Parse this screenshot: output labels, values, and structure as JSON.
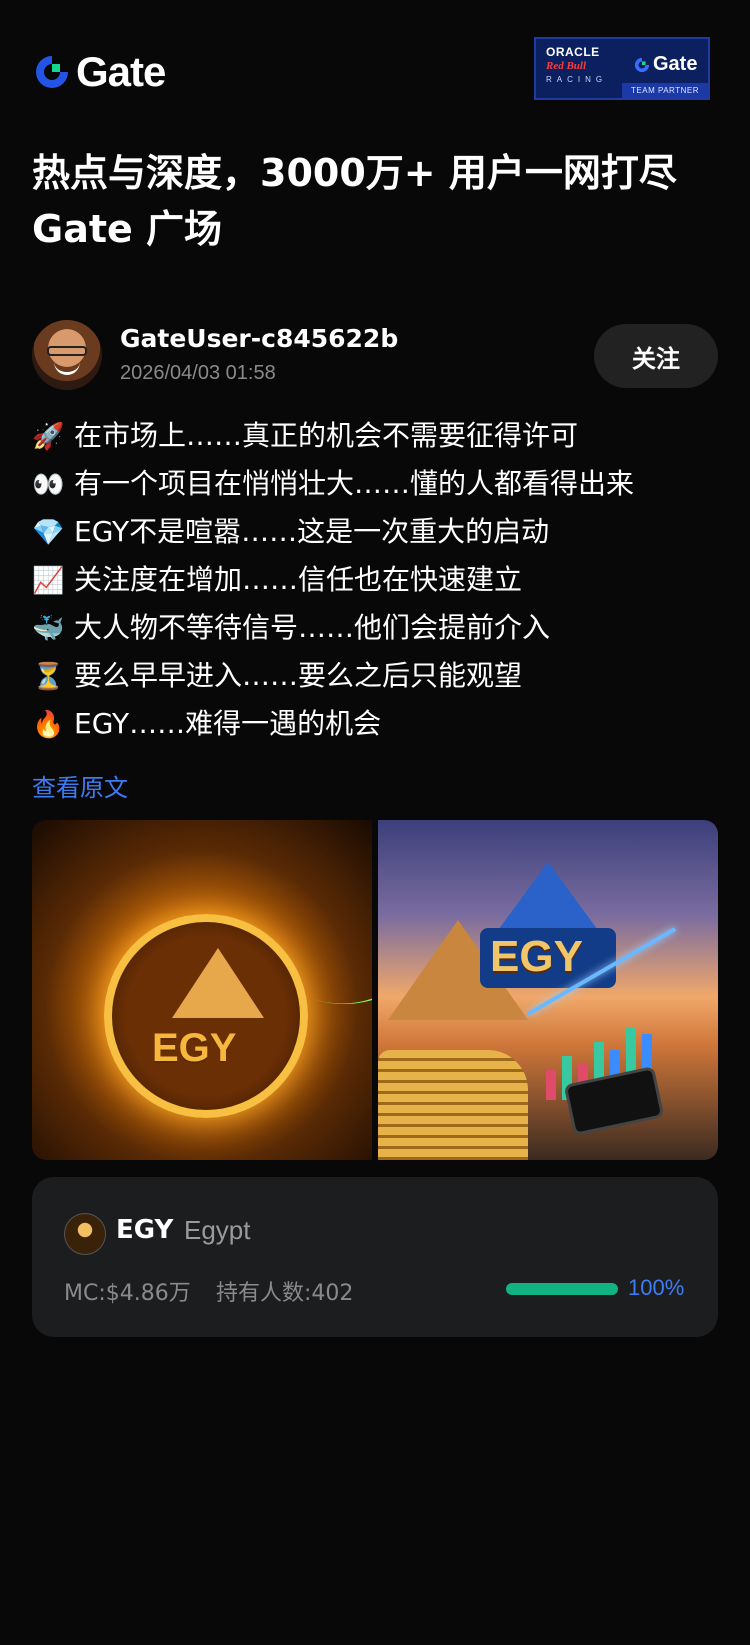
{
  "header": {
    "logo_text": "Gate",
    "partner": {
      "line1": "ORACLE",
      "line2": "Red Bull",
      "line3": "RACING",
      "brand": "Gate",
      "tagline": "TEAM PARTNER"
    }
  },
  "headline": "热点与深度，3000万+ 用户一网打尽 Gate 广场",
  "author": {
    "username": "GateUser-c845622b",
    "timestamp": "2026/04/03 01:58",
    "follow_label": "关注"
  },
  "post": {
    "lines": [
      {
        "emoji": "🚀",
        "text": "在市场上……真正的机会不需要征得许可"
      },
      {
        "emoji": "👀",
        "text": "有一个项目在悄悄壮大……懂的人都看得出来"
      },
      {
        "emoji": "💎",
        "text": "EGY不是喧嚣……这是一次重大的启动"
      },
      {
        "emoji": "📈",
        "text": "关注度在增加……信任也在快速建立"
      },
      {
        "emoji": "🐳",
        "text": "大人物不等待信号……他们会提前介入"
      },
      {
        "emoji": "⏳",
        "text": "要么早早进入……要么之后只能观望"
      },
      {
        "emoji": "🔥",
        "text": "EGY……难得一遇的机会"
      }
    ],
    "view_original": "查看原文"
  },
  "images": {
    "img1_text": "EGY",
    "img2_text": "EGY"
  },
  "token": {
    "symbol": "EGY",
    "name": "Egypt",
    "market_cap": "MC:$4.86万",
    "holders": "持有人数:402",
    "progress": "100%",
    "progress_value": 1.0,
    "progress_color": "#11b383",
    "accent_color": "#3d7cf5"
  }
}
